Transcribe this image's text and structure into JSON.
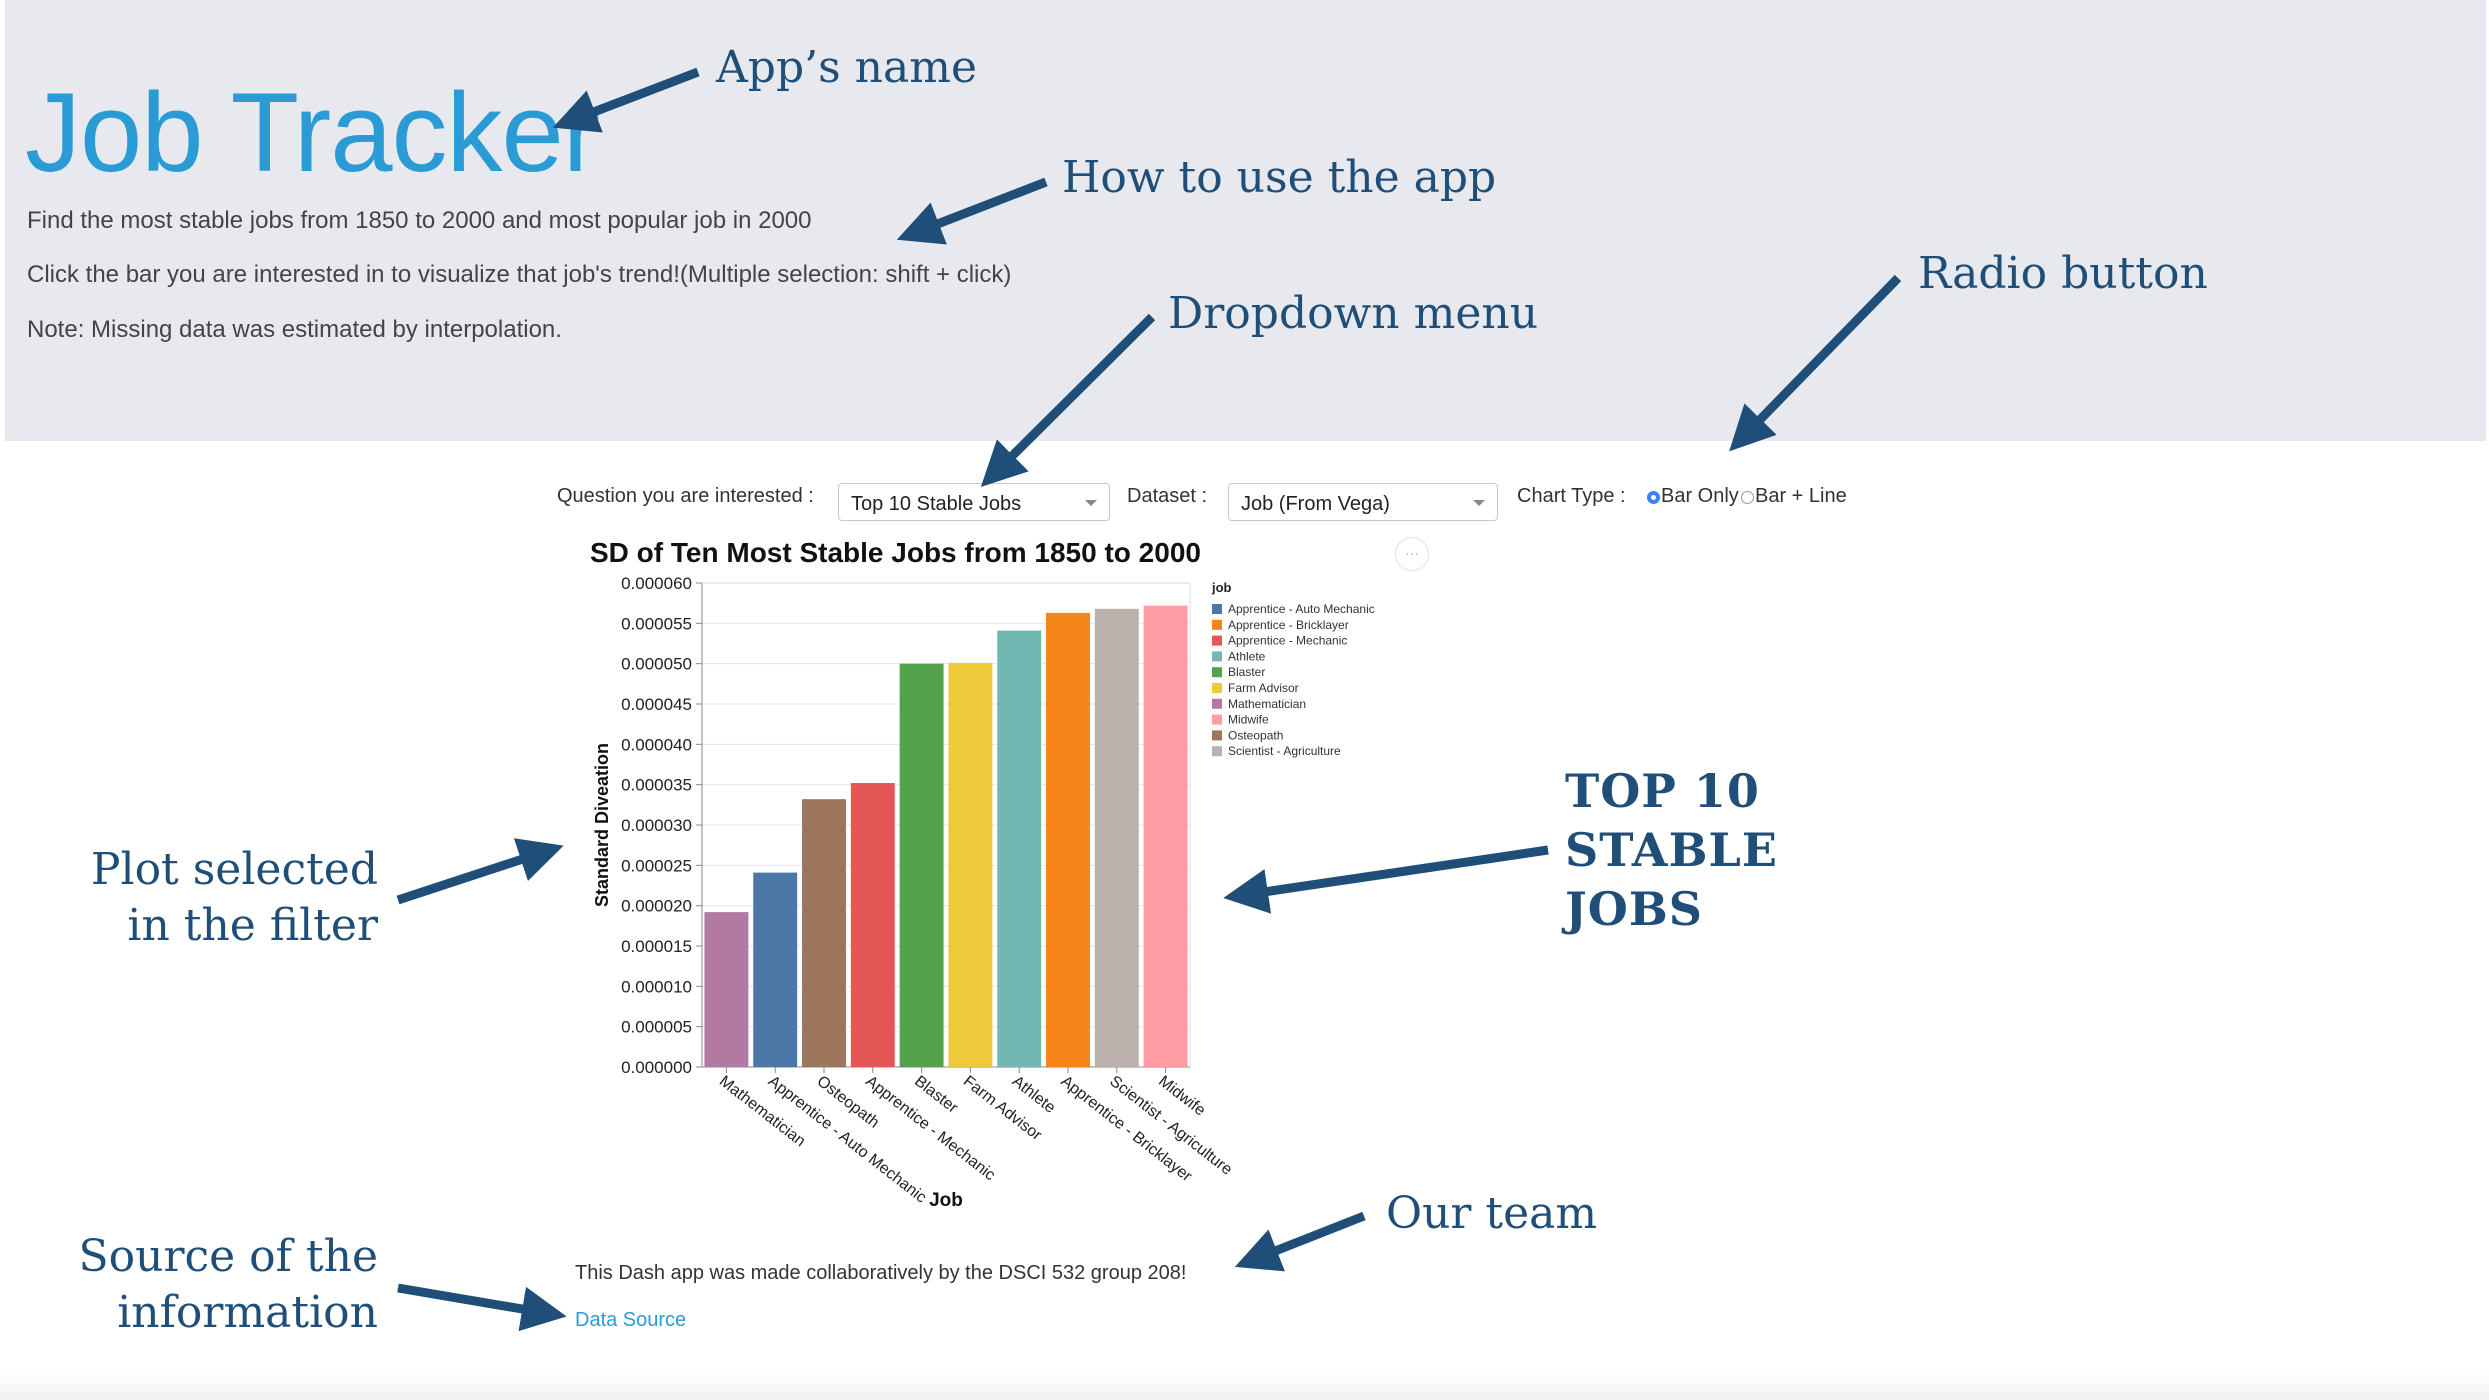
{
  "header": {
    "app_title": "Job Tracker",
    "descriptions": [
      "Find the most stable jobs from 1850 to 2000 and most popular job in 2000",
      "Click the bar you are interested in to visualize that job's trend!(Multiple selection: shift + click)",
      "Note: Missing data was estimated by interpolation."
    ]
  },
  "controls": {
    "question_label": "Question you are interested :",
    "question_value": "Top 10 Stable Jobs",
    "dataset_label": "Dataset :",
    "dataset_value": "Job (From Vega)",
    "chart_type_label": "Chart Type :",
    "chart_type_options": [
      "Bar Only",
      "Bar + Line"
    ],
    "chart_type_selected": "Bar Only"
  },
  "chart_data": {
    "type": "bar",
    "title": "SD of Ten Most Stable Jobs from 1850 to 2000",
    "xlabel": "Job",
    "ylabel": "Standard Diveation",
    "ylim": [
      0,
      6e-05
    ],
    "yticks": [
      "0.000000",
      "0.000005",
      "0.000010",
      "0.000015",
      "0.000020",
      "0.000025",
      "0.000030",
      "0.000035",
      "0.000040",
      "0.000045",
      "0.000050",
      "0.000055",
      "0.000060"
    ],
    "categories": [
      "Mathematician",
      "Apprentice - Auto Mechanic",
      "Osteopath",
      "Apprentice - Mechanic",
      "Blaster",
      "Farm Advisor",
      "Athlete",
      "Apprentice - Bricklayer",
      "Scientist - Agriculture",
      "Midwife"
    ],
    "values": [
      1.92e-05,
      2.41e-05,
      3.32e-05,
      3.52e-05,
      5e-05,
      5.01e-05,
      5.41e-05,
      5.63e-05,
      5.68e-05,
      5.72e-05
    ],
    "colors": [
      "#b279a2",
      "#4c78a8",
      "#9d755d",
      "#e45756",
      "#54a24b",
      "#eeca3b",
      "#72b7b2",
      "#f58518",
      "#bab0ac",
      "#ff9da6"
    ],
    "legend_title": "job",
    "legend_position": "right",
    "legend": [
      {
        "label": "Apprentice - Auto Mechanic",
        "color": "#4c78a8"
      },
      {
        "label": "Apprentice - Bricklayer",
        "color": "#f58518"
      },
      {
        "label": "Apprentice - Mechanic",
        "color": "#e45756"
      },
      {
        "label": "Athlete",
        "color": "#72b7b2"
      },
      {
        "label": "Blaster",
        "color": "#54a24b"
      },
      {
        "label": "Farm Advisor",
        "color": "#eeca3b"
      },
      {
        "label": "Mathematician",
        "color": "#b279a2"
      },
      {
        "label": "Midwife",
        "color": "#ff9da6"
      },
      {
        "label": "Osteopath",
        "color": "#9d755d"
      },
      {
        "label": "Scientist - Agriculture",
        "color": "#bab0ac"
      }
    ],
    "grid": true
  },
  "footer": {
    "team_text": "This Dash app was made collaboratively by the DSCI 532 group 208!",
    "source_link": "Data Source"
  },
  "annotations": {
    "app_name": "App’s name",
    "how_to_use": "How to use the app",
    "dropdown_menu": "Dropdown menu",
    "radio_button": "Radio button",
    "top10_line1": "TOP 10",
    "top10_line2": "STABLE",
    "top10_line3": "JOBS",
    "plot_selected_line1": "Plot selected",
    "plot_selected_line2": "in the filter",
    "our_team": "Our team",
    "source_line1": "Source of  the",
    "source_line2": "information"
  },
  "colors": {
    "header_bg": "#e8e9ee",
    "title_blue": "#2b9bd6",
    "annotation_blue": "#1f4e79"
  }
}
